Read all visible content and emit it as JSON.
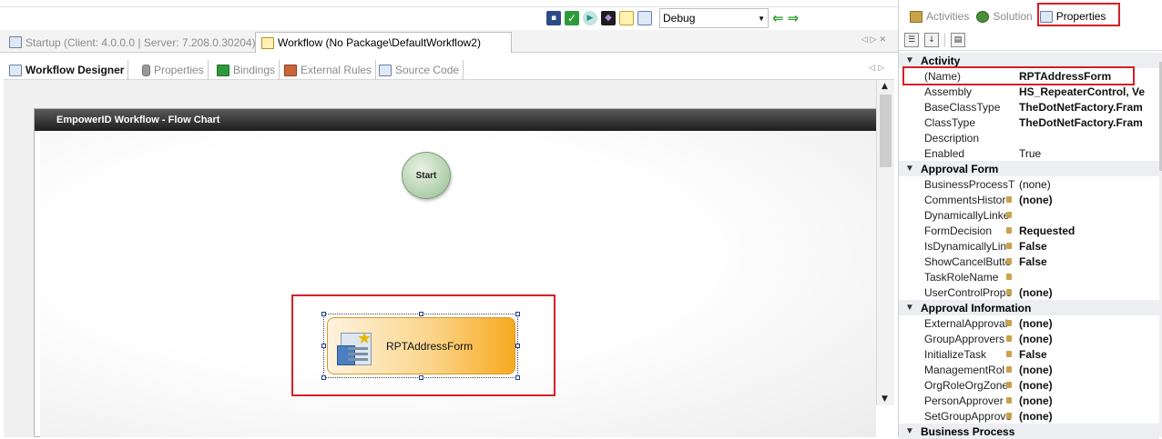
{
  "toolbar": {
    "config_value": "Debug"
  },
  "doc_tabs": [
    {
      "label": "Startup (Client: 4.0.0.0 | Server: 7.208.0.30204)"
    },
    {
      "label": "Workflow (No Package\\DefaultWorkflow2)"
    }
  ],
  "sub_tabs": [
    {
      "label": "Workflow Designer"
    },
    {
      "label": "Properties"
    },
    {
      "label": "Bindings"
    },
    {
      "label": "External Rules"
    },
    {
      "label": "Source Code"
    }
  ],
  "designer": {
    "header": "EmpowerID Workflow - Flow Chart",
    "start_label": "Start",
    "activity_label": "RPTAddressForm"
  },
  "right_tabs": [
    {
      "label": "Activities"
    },
    {
      "label": "Solution"
    },
    {
      "label": "Properties"
    }
  ],
  "grid": {
    "categories": {
      "activity": "Activity",
      "approval_form": "Approval Form",
      "approval_info": "Approval Information",
      "business_process": "Business Process"
    },
    "activity_rows": [
      {
        "name": "(Name)",
        "value": "RPTAddressForm"
      },
      {
        "name": "Assembly",
        "value": "HS_RepeaterControl, Ve"
      },
      {
        "name": "BaseClassType",
        "value": "TheDotNetFactory.Fram"
      },
      {
        "name": "ClassType",
        "value": "TheDotNetFactory.Fram"
      },
      {
        "name": "Description",
        "value": ""
      },
      {
        "name": "Enabled",
        "value": "True"
      }
    ],
    "approval_form_rows": [
      {
        "name": "BusinessProcessT",
        "value": "(none)"
      },
      {
        "name": "CommentsHistor",
        "value": "(none)"
      },
      {
        "name": "DynamicallyLinke",
        "value": ""
      },
      {
        "name": "FormDecision",
        "value": "Requested"
      },
      {
        "name": "IsDynamicallyLin",
        "value": "False"
      },
      {
        "name": "ShowCancelButto",
        "value": "False"
      },
      {
        "name": "TaskRoleName",
        "value": ""
      },
      {
        "name": "UserControlPrope",
        "value": "(none)"
      }
    ],
    "approval_info_rows": [
      {
        "name": "ExternalApproval",
        "value": "(none)"
      },
      {
        "name": "GroupApprovers",
        "value": "(none)"
      },
      {
        "name": "InitializeTask",
        "value": "False"
      },
      {
        "name": "ManagementRol",
        "value": "(none)"
      },
      {
        "name": "OrgRoleOrgZone",
        "value": "(none)"
      },
      {
        "name": "PersonApprover",
        "value": "(none)"
      },
      {
        "name": "SetGroupApprove",
        "value": "(none)"
      }
    ]
  }
}
